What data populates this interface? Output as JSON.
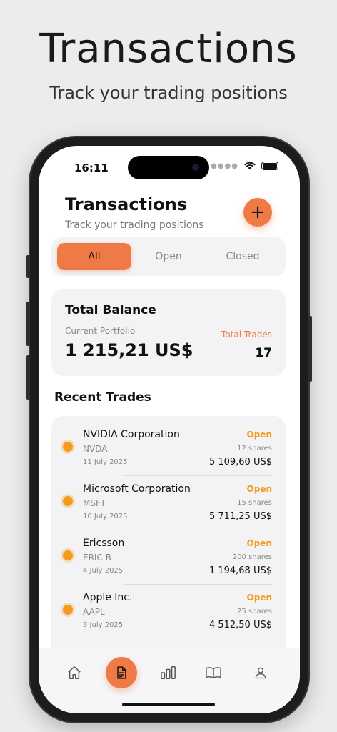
{
  "promo": {
    "title": "Transactions",
    "subtitle": "Track your trading positions"
  },
  "status_bar": {
    "time": "16:11"
  },
  "header": {
    "title": "Transactions",
    "subtitle": "Track your trading positions",
    "add_label": "+"
  },
  "segments": [
    {
      "label": "All",
      "active": true
    },
    {
      "label": "Open",
      "active": false
    },
    {
      "label": "Closed",
      "active": false
    }
  ],
  "balance": {
    "title": "Total Balance",
    "portfolio_label": "Current Portfolio",
    "amount": "1 215,21 US$",
    "trades_label": "Total Trades",
    "trades_count": "17"
  },
  "recent": {
    "title": "Recent Trades",
    "items": [
      {
        "name": "NVIDIA Corporation",
        "ticker": "NVDA",
        "date": "11 July 2025",
        "status": "Open",
        "shares": "12 shares",
        "value": "5 109,60 US$"
      },
      {
        "name": "Microsoft Corporation",
        "ticker": "MSFT",
        "date": "10 July 2025",
        "status": "Open",
        "shares": "15 shares",
        "value": "5 711,25 US$"
      },
      {
        "name": "Ericsson",
        "ticker": "ERIC B",
        "date": "4 July 2025",
        "status": "Open",
        "shares": "200 shares",
        "value": "1 194,68 US$"
      },
      {
        "name": "Apple Inc.",
        "ticker": "AAPL",
        "date": "3 July 2025",
        "status": "Open",
        "shares": "25 shares",
        "value": "4 512,50 US$"
      }
    ]
  },
  "tabbar": {
    "icons": [
      "home-icon",
      "document-icon",
      "bar-chart-icon",
      "book-icon",
      "user-icon"
    ],
    "active": "document-icon"
  },
  "colors": {
    "accent": "#ef7a45",
    "open_status": "#f39a1f",
    "card_bg": "#f3f3f5"
  }
}
